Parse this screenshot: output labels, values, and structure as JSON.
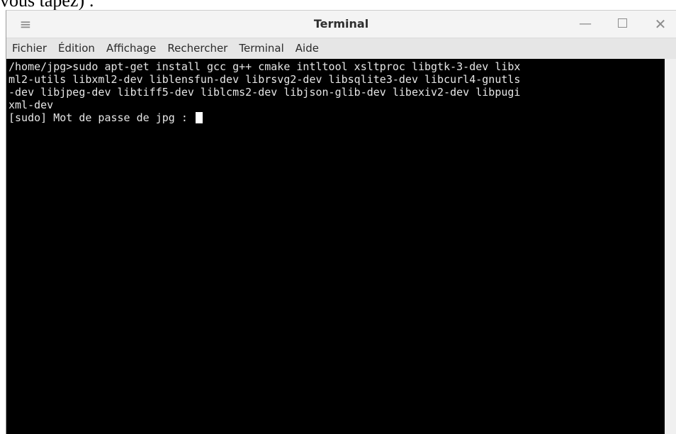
{
  "above_text": "vous tapez) :",
  "window": {
    "title": "Terminal",
    "menu_icon": "hamburger-menu-icon",
    "buttons": {
      "minimize": "—",
      "close": "✕"
    }
  },
  "menubar": {
    "items": [
      "Fichier",
      "Édition",
      "Affichage",
      "Rechercher",
      "Terminal",
      "Aide"
    ]
  },
  "terminal": {
    "lines": [
      "/home/jpg>sudo apt-get install gcc g++ cmake intltool xsltproc libgtk-3-dev libx",
      "ml2-utils libxml2-dev liblensfun-dev librsvg2-dev libsqlite3-dev libcurl4-gnutls",
      "-dev libjpeg-dev libtiff5-dev liblcms2-dev libjson-glib-dev libexiv2-dev libpugi",
      "xml-dev"
    ],
    "prompt": "[sudo] Mot de passe de jpg : "
  },
  "colors": {
    "terminal_bg": "#000000",
    "terminal_fg": "#e6e6e6",
    "titlebar_bg": "#f4f4f4",
    "menubar_bg": "#e6e6e6"
  }
}
